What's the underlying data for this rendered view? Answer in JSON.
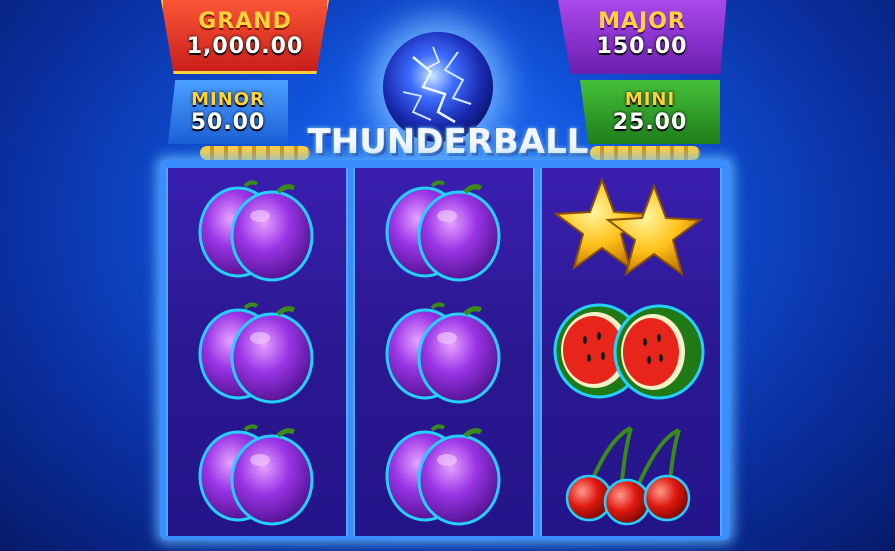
{
  "jackpots": {
    "grand": {
      "label": "GRAND",
      "value": "1,000.00"
    },
    "major": {
      "label": "MAJOR",
      "value": "150.00"
    },
    "minor": {
      "label": "MINOR",
      "value": "50.00"
    },
    "mini": {
      "label": "MINI",
      "value": "25.00"
    }
  },
  "game_title": "THUNDERBALL",
  "reels": [
    [
      "plum",
      "plum",
      "plum"
    ],
    [
      "plum",
      "plum",
      "plum"
    ],
    [
      "star",
      "watermelon",
      "cherry"
    ]
  ],
  "colors": {
    "grand": "#d8261e",
    "major": "#8a2fd0",
    "minor": "#2b74e8",
    "mini": "#2f9a26",
    "reel_bg": "#2a1890"
  }
}
